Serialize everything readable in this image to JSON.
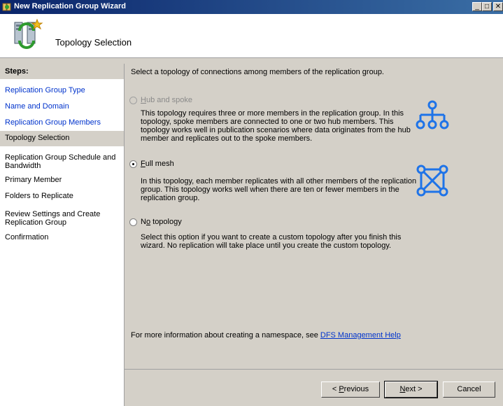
{
  "window": {
    "title": "New Replication Group Wizard",
    "controls": {
      "minimize": "_",
      "maximize": "□",
      "close": "✕"
    }
  },
  "header": {
    "page_title": "Topology Selection",
    "icon": "replication-wizard-icon"
  },
  "steps": {
    "heading": "Steps:",
    "items": [
      {
        "label": "Replication Group Type",
        "state": "link"
      },
      {
        "label": "Name and Domain",
        "state": "link"
      },
      {
        "label": "Replication Group Members",
        "state": "link"
      },
      {
        "label": "Topology Selection",
        "state": "current"
      },
      {
        "label": "Replication Group Schedule and Bandwidth",
        "state": "plain"
      },
      {
        "label": "Primary Member",
        "state": "plain"
      },
      {
        "label": "Folders to Replicate",
        "state": "plain"
      },
      {
        "label": "Review Settings and Create Replication Group",
        "state": "plain"
      },
      {
        "label": "Confirmation",
        "state": "plain"
      }
    ]
  },
  "main": {
    "intro": "Select a topology of connections among members of the replication group.",
    "options": {
      "hub": {
        "mnemonic": "H",
        "rest": "ub and spoke",
        "checked": false,
        "enabled": false,
        "description": "This topology requires three or more members in the replication group. In this topology, spoke members are connected to one or two hub members. This topology works well in publication scenarios where data originates from the hub member and replicates out to the spoke members.",
        "icon": "hub-spoke-topology-icon"
      },
      "mesh": {
        "mnemonic": "F",
        "rest": "ull mesh",
        "checked": true,
        "enabled": true,
        "description": "In this topology, each member replicates with all other members of the replication group. This topology works well when there are ten or fewer members in the replication group.",
        "icon": "full-mesh-topology-icon"
      },
      "none": {
        "prefix": "N",
        "mnemonic": "o",
        "rest": " topology",
        "checked": false,
        "enabled": true,
        "description": "Select this option if you want to create a custom topology after you finish this wizard. No replication will take place until you create the custom topology."
      }
    },
    "help_text": "For more information about creating a namespace, see",
    "help_link": "DFS Management Help"
  },
  "buttons": {
    "previous": {
      "arrow": "< ",
      "mnemonic": "P",
      "rest": "revious"
    },
    "next": {
      "mnemonic": "N",
      "rest": "ext >"
    },
    "cancel": "Cancel"
  },
  "colors": {
    "title_bar": "#0a246a",
    "link": "#0033cc",
    "dialog": "#d4d0c8",
    "topology_icon": "#1e73e8"
  }
}
